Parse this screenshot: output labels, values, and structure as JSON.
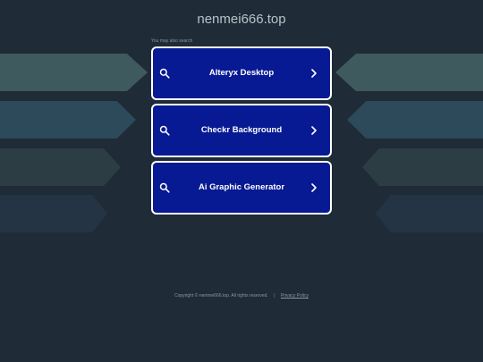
{
  "header": {
    "title": "nenmei666.top"
  },
  "hint_text": "You may also search",
  "search_links": [
    {
      "label": "Alteryx Desktop",
      "icon": "search-icon",
      "chevron": "chevron-right-icon"
    },
    {
      "label": "Checkr Background",
      "icon": "search-icon",
      "chevron": "chevron-right-icon"
    },
    {
      "label": "Ai Graphic Generator",
      "icon": "search-icon",
      "chevron": "chevron-right-icon"
    }
  ],
  "footer": {
    "copyright": "Copyright © nenmei666.top.  All rights reserved.",
    "separator": "|",
    "privacy_label": "Privacy Policy"
  },
  "colors": {
    "background": "#1f2b36",
    "button_fill": "#071a93",
    "button_border": "#ffffff",
    "title_text": "#b8c2c9"
  }
}
